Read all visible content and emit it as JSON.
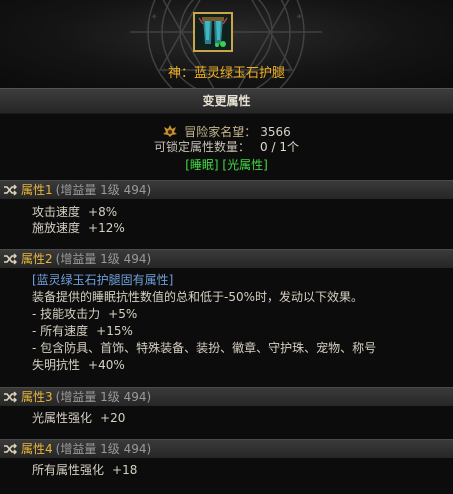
{
  "item": {
    "name": "神：蓝灵绿玉石护腿"
  },
  "change_button": {
    "label": "变更属性"
  },
  "summary": {
    "fame_label": "冒险家名望：",
    "fame_value": "3566",
    "lockable_label": "可锁定属性数量：",
    "lockable_value": "0 / 1个",
    "tags": "[睡眠] [光属性]"
  },
  "sections": [
    {
      "title": "属性1",
      "subtitle": "(增益量 1级 494)",
      "lines": [
        {
          "label": "攻击速度",
          "value": "+8%"
        },
        {
          "label": "施放速度",
          "value": "+12%"
        }
      ]
    },
    {
      "title": "属性2",
      "subtitle": "(增益量 1级 494)",
      "fixed_header": "[蓝灵绿玉石护腿固有属性]",
      "description": "装备提供的睡眠抗性数值的总和低于-50%时，发动以下效果。",
      "lines": [
        {
          "label": "- 技能攻击力",
          "value": "+5%"
        },
        {
          "label": "- 所有速度",
          "value": "+15%"
        },
        {
          "label": "- 包含防具、首饰、特殊装备、装扮、徽章、守护珠、宠物、称号",
          "value": ""
        },
        {
          "label": "失明抗性",
          "value": "+40%"
        }
      ]
    },
    {
      "title": "属性3",
      "subtitle": "(增益量 1级 494)",
      "lines": [
        {
          "label": "光属性强化",
          "value": "+20"
        }
      ]
    },
    {
      "title": "属性4",
      "subtitle": "(增益量 1级 494)",
      "lines": [
        {
          "label": "所有属性强化",
          "value": "+18"
        }
      ]
    }
  ],
  "colors": {
    "item_name": "#f0b020",
    "section_title": "#e8b63a",
    "tags": "#44d844",
    "fixed_header": "#6ea0dc"
  },
  "icons": {
    "item": "leggings-icon",
    "fame": "fame-emblem-icon",
    "section": "shuffle-icon"
  }
}
